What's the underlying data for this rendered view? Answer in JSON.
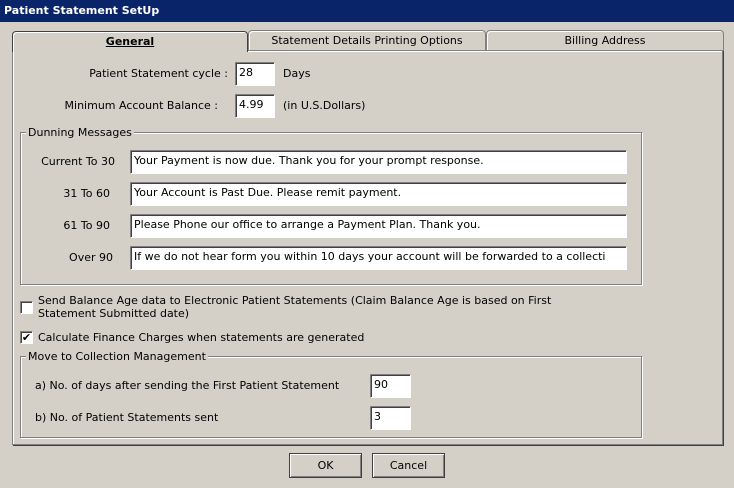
{
  "window": {
    "title": "Patient Statement SetUp"
  },
  "tabs": [
    {
      "label": "General",
      "active": true
    },
    {
      "label": "Statement Details Printing Options",
      "active": false
    },
    {
      "label": "Billing Address",
      "active": false
    }
  ],
  "general": {
    "cycle_label": "Patient Statement cycle :",
    "cycle_value": "28",
    "cycle_unit": "Days",
    "min_balance_label": "Minimum Account Balance :",
    "min_balance_value": "4.99",
    "min_balance_unit": "(in U.S.Dollars)"
  },
  "dunning": {
    "title": "Dunning Messages",
    "rows": [
      {
        "label": "Current To 30",
        "value": "Your Payment is now due. Thank you for your prompt response."
      },
      {
        "label": "31 To 60",
        "value": "Your Account is Past Due. Please remit payment."
      },
      {
        "label": "61 To 90",
        "value": "Please Phone our office to arrange a Payment Plan. Thank you."
      },
      {
        "label": "Over 90",
        "value": "If we do not hear form you within 10 days your account will be forwarded to a collecti"
      }
    ]
  },
  "options": {
    "send_balance_age": {
      "label": "Send Balance Age data to Electronic Patient Statements  (Claim Balance Age is based on First Statement Submitted date)",
      "checked": false
    },
    "calc_finance": {
      "label": "Calculate Finance Charges when statements are generated",
      "checked": true,
      "mark": "✔"
    }
  },
  "collection": {
    "title": "Move to Collection Management",
    "days_label": "a) No. of days after sending the First Patient Statement",
    "days_value": "90",
    "count_label": "b) No. of Patient Statements sent",
    "count_value": "3"
  },
  "buttons": {
    "ok": "OK",
    "cancel": "Cancel"
  }
}
